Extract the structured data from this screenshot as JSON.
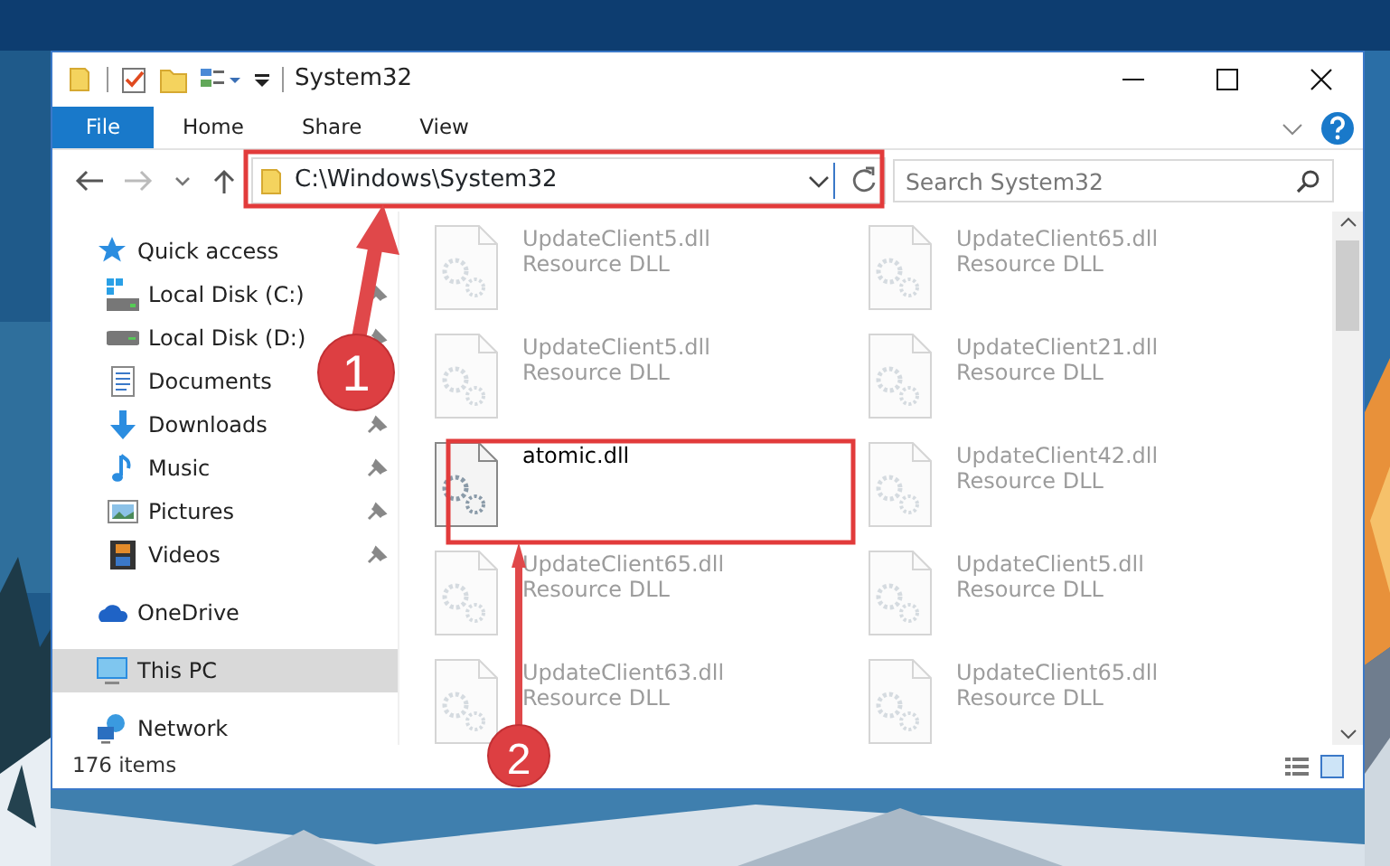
{
  "window": {
    "title": "System32"
  },
  "ribbon": {
    "tabs": [
      {
        "label": "File",
        "kind": "file"
      },
      {
        "label": "Home",
        "kind": "tab"
      },
      {
        "label": "Share",
        "kind": "tab"
      },
      {
        "label": "View",
        "kind": "tab"
      }
    ]
  },
  "address_bar": {
    "path": "C:\\Windows\\System32"
  },
  "search": {
    "placeholder": "Search System32"
  },
  "navigation": [
    {
      "label": "Quick access",
      "kind": "star",
      "selected": false,
      "children": [
        {
          "label": "Local Disk (C:)",
          "kind": "drive-win",
          "pinned": true
        },
        {
          "label": "Local Disk (D:)",
          "kind": "drive",
          "pinned": true
        },
        {
          "label": "Documents",
          "kind": "document",
          "pinned": false
        },
        {
          "label": "Downloads",
          "kind": "download",
          "pinned": true
        },
        {
          "label": "Music",
          "kind": "music",
          "pinned": true
        },
        {
          "label": "Pictures",
          "kind": "pictures",
          "pinned": true
        },
        {
          "label": "Videos",
          "kind": "videos",
          "pinned": true
        }
      ]
    },
    {
      "label": "OneDrive",
      "kind": "cloud",
      "selected": false
    },
    {
      "label": "This PC",
      "kind": "pc",
      "selected": true
    },
    {
      "label": "Network",
      "kind": "network",
      "selected": false
    }
  ],
  "files": [
    {
      "name": "UpdateClient5.dll",
      "type": "Resource DLL",
      "blurred": true
    },
    {
      "name": "UpdateClient65.dll",
      "type": "Resource DLL",
      "blurred": true
    },
    {
      "name": "UpdateClient5.dll",
      "type": "Resource DLL",
      "blurred": true
    },
    {
      "name": "UpdateClient21.dll",
      "type": "Resource DLL",
      "blurred": true
    },
    {
      "name": "atomic.dll",
      "blurred": false
    },
    {
      "name": "UpdateClient42.dll",
      "type": "Resource DLL",
      "blurred": true
    },
    {
      "name": "UpdateClient65.dll",
      "type": "Resource DLL",
      "blurred": true
    },
    {
      "name": "UpdateClient5.dll",
      "type": "Resource DLL",
      "blurred": true
    },
    {
      "name": "UpdateClient63.dll",
      "type": "Resource DLL",
      "blurred": true
    },
    {
      "name": "UpdateClient65.dll",
      "type": "Resource DLL",
      "blurred": true
    }
  ],
  "status_bar": {
    "count": "176 items"
  },
  "annotations": [
    {
      "number": "1"
    },
    {
      "number": "2"
    }
  ]
}
